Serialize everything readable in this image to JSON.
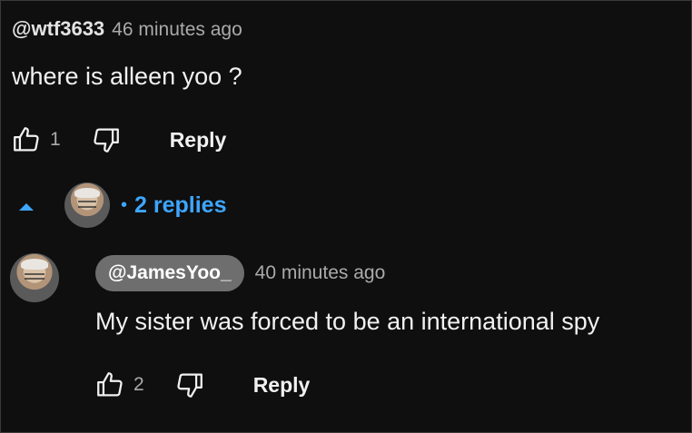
{
  "comment": {
    "author": "@wtf3633",
    "time": "46 minutes ago",
    "text": "where is alleen yoo ?",
    "like_count": "1",
    "reply_label": "Reply"
  },
  "replies_toggle": {
    "label": "2 replies",
    "dot": "•"
  },
  "reply": {
    "author": "@JamesYoo_",
    "time": "40 minutes ago",
    "text": "My sister was forced to be an international spy",
    "like_count": "2",
    "reply_label": "Reply"
  },
  "colors": {
    "background": "#0f0f0f",
    "accent_blue": "#3ea6ff",
    "muted_text": "#aaaaaa",
    "author_chip": "#6e6e6e"
  },
  "icons": [
    "thumbs-up-icon",
    "thumbs-down-icon",
    "caret-up-icon",
    "avatar"
  ]
}
